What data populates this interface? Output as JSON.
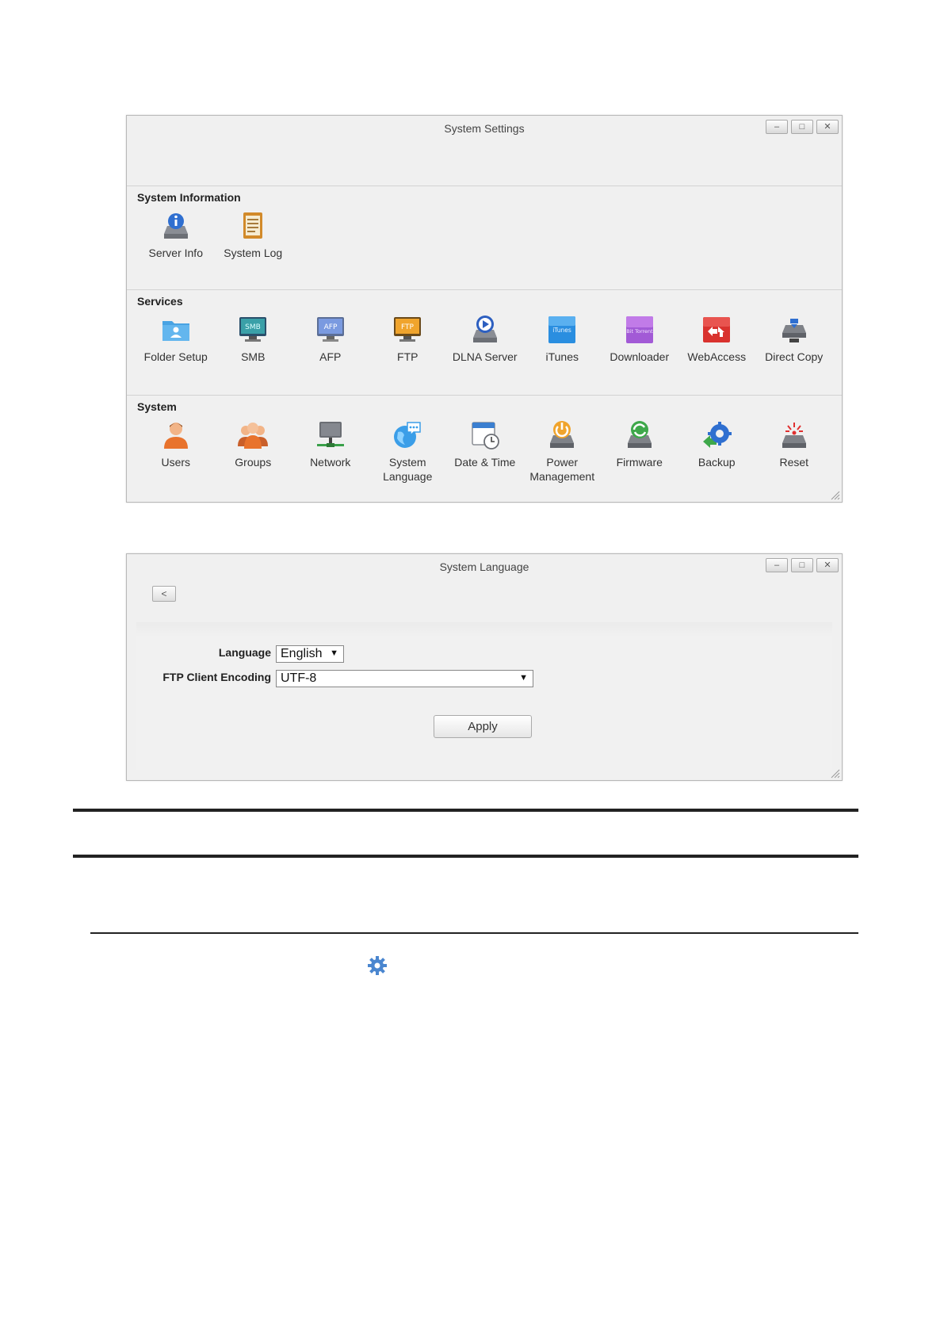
{
  "settings_window": {
    "title": "System Settings",
    "controls": [
      "minimize-icon",
      "maximize-icon",
      "close-icon"
    ],
    "sections": [
      {
        "title": "System Information",
        "items": [
          {
            "label": "Server Info",
            "icon": "server-info-icon"
          },
          {
            "label": "System Log",
            "icon": "system-log-icon"
          }
        ]
      },
      {
        "title": "Services",
        "items": [
          {
            "label": "Folder Setup",
            "icon": "folder-setup-icon"
          },
          {
            "label": "SMB",
            "icon": "smb-icon"
          },
          {
            "label": "AFP",
            "icon": "afp-icon"
          },
          {
            "label": "FTP",
            "icon": "ftp-icon"
          },
          {
            "label": "DLNA Server",
            "icon": "dlna-server-icon"
          },
          {
            "label": "iTunes",
            "icon": "itunes-icon"
          },
          {
            "label": "Downloader",
            "icon": "downloader-icon"
          },
          {
            "label": "WebAccess",
            "icon": "webaccess-icon"
          },
          {
            "label": "Direct Copy",
            "icon": "direct-copy-icon"
          }
        ]
      },
      {
        "title": "System",
        "items": [
          {
            "label": "Users",
            "icon": "users-icon"
          },
          {
            "label": "Groups",
            "icon": "groups-icon"
          },
          {
            "label": "Network",
            "icon": "network-icon"
          },
          {
            "label": "System\nLanguage",
            "icon": "system-language-icon"
          },
          {
            "label": "Date & Time",
            "icon": "date-time-icon"
          },
          {
            "label": "Power\nManagement",
            "icon": "power-management-icon"
          },
          {
            "label": "Firmware",
            "icon": "firmware-icon"
          },
          {
            "label": "Backup",
            "icon": "backup-icon"
          },
          {
            "label": "Reset",
            "icon": "reset-icon"
          }
        ]
      }
    ],
    "icon_texts": {
      "smb": "SMB",
      "afp": "AFP",
      "ftp": "FTP",
      "itunes": "iTunes",
      "downloader": "Bit Torrent"
    }
  },
  "language_window": {
    "title": "System Language",
    "back_label": "<",
    "language_label": "Language",
    "language_value": "English",
    "encoding_label": "FTP Client Encoding",
    "encoding_value": "UTF-8",
    "apply_label": "Apply"
  },
  "colors": {
    "window_bg": "#f0f0f0",
    "accent_blue": "#3d7fd0",
    "gear_blue": "#4a86cf"
  }
}
